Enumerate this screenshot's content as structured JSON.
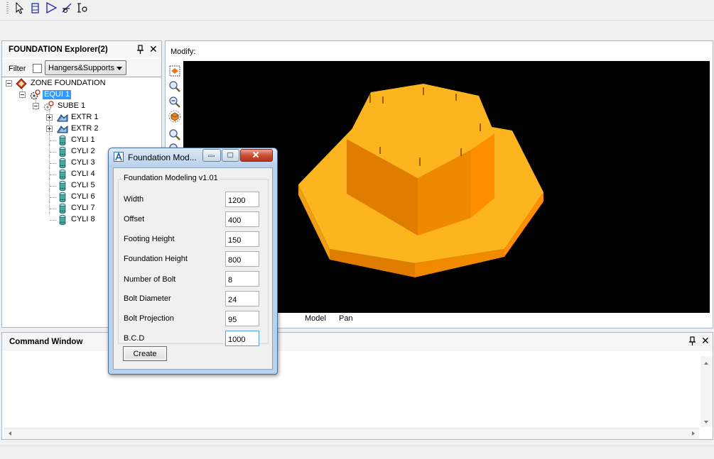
{
  "explorer": {
    "title": "FOUNDATION Explorer(2)",
    "filter_label": "Filter",
    "filter_value": "Hangers&Supports",
    "tree": {
      "root": "ZONE FOUNDATION",
      "equi": "EQUI 1",
      "sube": "SUBE 1",
      "items": [
        "EXTR 1",
        "EXTR 2",
        "CYLI 1",
        "CYLI 2",
        "CYLI 3",
        "CYLI 4",
        "CYLI 5",
        "CYLI 6",
        "CYLI 7",
        "CYLI 8"
      ]
    }
  },
  "viewport": {
    "label": "Modify:",
    "tabs": [
      "Model",
      "Pan"
    ]
  },
  "command_window": {
    "title": "Command Window"
  },
  "dialog": {
    "title": "Foundation Mod...",
    "group_title": "Foundation Modeling v1.01",
    "fields": [
      {
        "label": "Width",
        "value": "1200"
      },
      {
        "label": "Offset",
        "value": "400"
      },
      {
        "label": "Footing Height",
        "value": "150"
      },
      {
        "label": "Foundation Height",
        "value": "800"
      },
      {
        "label": "Number of Bolt",
        "value": "8"
      },
      {
        "label": "Bolt Diameter",
        "value": "24"
      },
      {
        "label": "Bolt Projection",
        "value": "95"
      },
      {
        "label": "B.C.D",
        "value": "1000"
      }
    ],
    "create_label": "Create"
  },
  "icons": {
    "toolbar": [
      "select-arrow-icon",
      "box-icon",
      "play-triangle-icon",
      "axis-tool-icon",
      "io-tool-icon"
    ],
    "viewport_tools": [
      "zoom-extents-icon",
      "zoom-in-icon",
      "zoom-out-icon",
      "render-cube-icon",
      "zoom-window-icon"
    ]
  },
  "colors": {
    "model_top": "#fdb51f",
    "model_side_dark": "#e07d00",
    "model_side_mid": "#ed9e12",
    "model_side_light": "#ff8e00",
    "viewport_bg": "#000000",
    "selection": "#3399ff",
    "dialog_frame": "#b9d1ea"
  }
}
